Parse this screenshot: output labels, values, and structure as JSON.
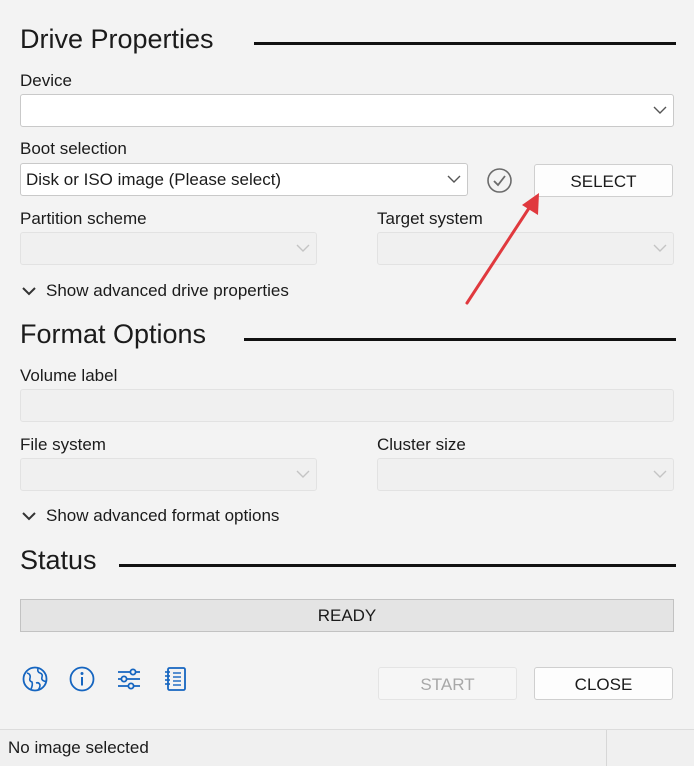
{
  "drive_properties": {
    "title": "Drive Properties",
    "device_label": "Device",
    "device_value": "",
    "boot_selection_label": "Boot selection",
    "boot_selection_value": "Disk or ISO image (Please select)",
    "select_button": "SELECT",
    "partition_scheme_label": "Partition scheme",
    "target_system_label": "Target system",
    "advanced_toggle": "Show advanced drive properties"
  },
  "format_options": {
    "title": "Format Options",
    "volume_label_label": "Volume label",
    "volume_label_value": "",
    "file_system_label": "File system",
    "cluster_size_label": "Cluster size",
    "advanced_toggle": "Show advanced format options"
  },
  "status": {
    "title": "Status",
    "progress_text": "READY",
    "progress_fraction": 0
  },
  "buttons": {
    "start": "START",
    "close": "CLOSE"
  },
  "toolbar_icons": [
    "globe-icon",
    "info-icon",
    "settings-sliders-icon",
    "log-icon"
  ],
  "footer": {
    "message": "No image selected"
  },
  "colors": {
    "background": "#f3f3f3",
    "annotation_arrow": "#e0393e",
    "section_rule": "#111111",
    "icon_blue": "#1565c0"
  }
}
